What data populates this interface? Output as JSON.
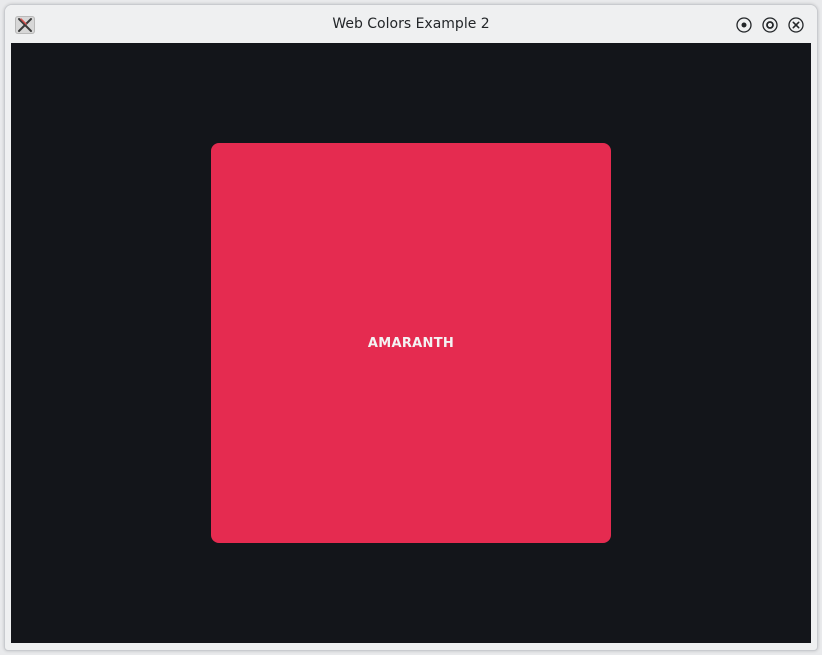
{
  "window": {
    "title": "Web Colors Example 2",
    "app_icon": "x-app-icon",
    "buttons": {
      "minimize_icon": "minimize-icon",
      "maximize_icon": "maximize-icon",
      "close_icon": "close-icon"
    }
  },
  "content": {
    "background_color": "#13151a",
    "swatch": {
      "label": "AMARANTH",
      "color": "#e52b50"
    }
  }
}
